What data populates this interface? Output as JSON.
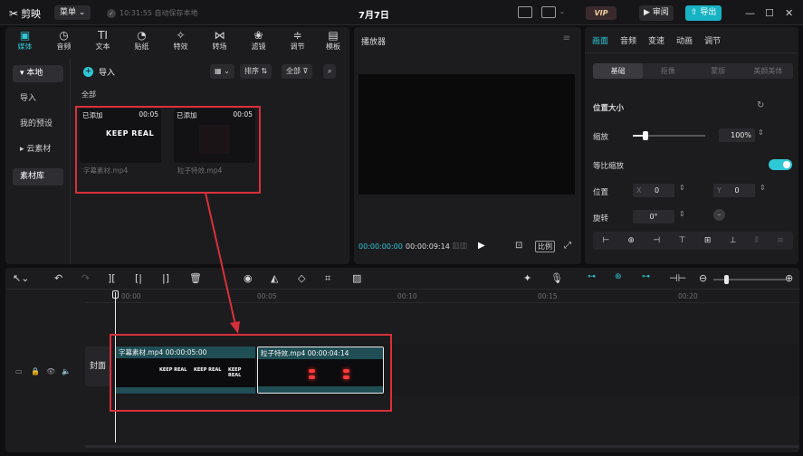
{
  "titlebar": {
    "app_name": "剪映",
    "menu_label": "菜单",
    "autosave_text": "10:31:55 自动保存本地",
    "project_title": "7月7日",
    "vip_label": "VIP",
    "review_label": "审阅",
    "export_label": "导出"
  },
  "media": {
    "tabs": [
      {
        "label": "媒体",
        "icon": "media-icon"
      },
      {
        "label": "音频",
        "icon": "audio-icon"
      },
      {
        "label": "文本",
        "icon": "text-icon"
      },
      {
        "label": "贴纸",
        "icon": "sticker-icon"
      },
      {
        "label": "特效",
        "icon": "effects-icon"
      },
      {
        "label": "转场",
        "icon": "transition-icon"
      },
      {
        "label": "滤镜",
        "icon": "filter-icon"
      },
      {
        "label": "调节",
        "icon": "adjust-icon"
      },
      {
        "label": "模板",
        "icon": "template-icon"
      }
    ],
    "side": [
      "本地",
      "导入",
      "我的预设",
      "云素材",
      "素材库"
    ],
    "import_label": "导入",
    "sort_label": "排序",
    "all_filter_label": "全部",
    "section_label": "全部",
    "clips": [
      {
        "tag": "已添加",
        "duration": "00:05",
        "name": "字幕素材.mp4",
        "thumb_text": "KEEP REAL"
      },
      {
        "tag": "已添加",
        "duration": "00:05",
        "name": "粒子特效.mp4"
      }
    ]
  },
  "player": {
    "title": "播放器",
    "current_time": "00:00:00:00",
    "total_time": "00:00:09:14",
    "ratio_label": "比例"
  },
  "properties": {
    "tabs": [
      "画面",
      "音频",
      "变速",
      "动画",
      "调节"
    ],
    "sub_tabs": [
      "基础",
      "抠像",
      "蒙版",
      "美颜美体"
    ],
    "section_title": "位置大小",
    "scale_label": "缩放",
    "scale_value": "100%",
    "uniform_scale_label": "等比缩放",
    "position_label": "位置",
    "x_label": "X",
    "x_value": "0",
    "y_label": "Y",
    "y_value": "0",
    "rotate_label": "旋转",
    "rotate_value": "0°",
    "scale_fraction": 0.17
  },
  "timeline": {
    "ruler": [
      "00:00",
      "00:05",
      "00:10",
      "00:15",
      "00:20"
    ],
    "cover_label": "封面",
    "clips": [
      {
        "title": "字幕素材.mp4  00:00:05:00",
        "frames": [
          "KEEP REAL",
          "KEEP REAL",
          "KEEP REAL"
        ]
      },
      {
        "title": "粒子特效.mp4  00:00:04:14"
      }
    ]
  },
  "colors": {
    "accent": "#2ec8d6",
    "annotation_red": "#d8303a",
    "clip_header": "#1f4e55"
  }
}
